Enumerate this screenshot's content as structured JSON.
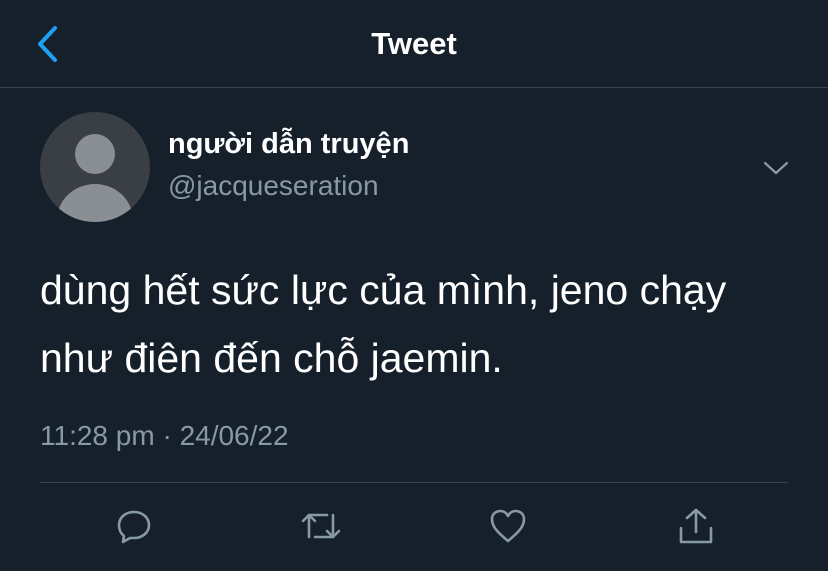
{
  "header": {
    "title": "Tweet",
    "back_icon": "chevron-left-icon"
  },
  "tweet": {
    "author": {
      "display_name": "người dẫn truyện",
      "handle": "@jacqueseration"
    },
    "text": "dùng hết sức lực của mình, jeno chạy như điên đến chỗ jaemin.",
    "time": "11:28 pm",
    "separator": "·",
    "date": "24/06/22"
  },
  "actions": [
    {
      "icon": "reply-icon"
    },
    {
      "icon": "retweet-icon"
    },
    {
      "icon": "like-icon"
    },
    {
      "icon": "share-icon"
    }
  ],
  "colors": {
    "background": "#15202b",
    "accent": "#1da1f2",
    "secondary_text": "#8899a6",
    "divider": "#38444d"
  }
}
